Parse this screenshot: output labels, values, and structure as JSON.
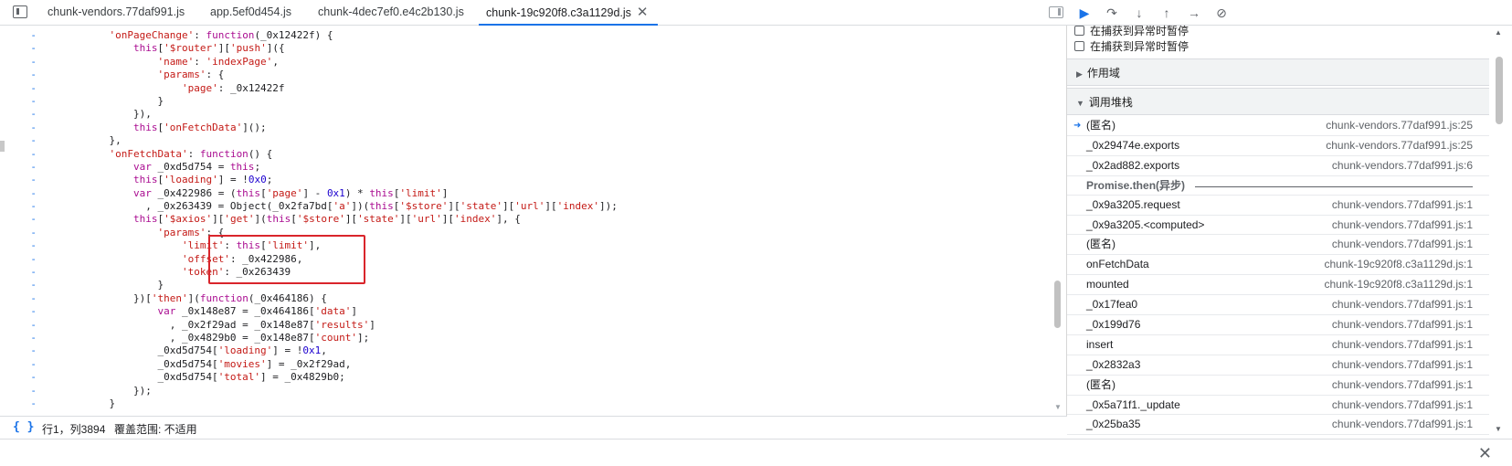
{
  "tabs": [
    {
      "label": "chunk-vendors.77daf991.js",
      "active": false
    },
    {
      "label": "app.5ef0d454.js",
      "active": false
    },
    {
      "label": "chunk-4dec7ef0.e4c2b130.js",
      "active": false
    },
    {
      "label": "chunk-19c920f8.c3a1129d.js",
      "active": true
    }
  ],
  "tab_close_glyph": "✕",
  "code_lines": [
    {
      "mark": "-",
      "html": "            <span class='c-str'>'onPageChange'</span>: <span class='c-kw'>function</span>(_0x12422f) {"
    },
    {
      "mark": "-",
      "html": "                <span class='c-kw'>this</span>[<span class='c-str'>'$router'</span>][<span class='c-str'>'push'</span>]({"
    },
    {
      "mark": "-",
      "html": "                    <span class='c-str'>'name'</span>: <span class='c-str'>'indexPage'</span>,"
    },
    {
      "mark": "-",
      "html": "                    <span class='c-str'>'params'</span>: {"
    },
    {
      "mark": "-",
      "html": "                        <span class='c-str'>'page'</span>: _0x12422f"
    },
    {
      "mark": "-",
      "html": "                    }"
    },
    {
      "mark": "-",
      "html": "                }),"
    },
    {
      "mark": "-",
      "html": "                <span class='c-kw'>this</span>[<span class='c-str'>'onFetchData'</span>]();"
    },
    {
      "mark": "-",
      "html": "            },"
    },
    {
      "mark": "-",
      "html": "            <span class='c-str'>'onFetchData'</span>: <span class='c-kw'>function</span>() {"
    },
    {
      "mark": "-",
      "html": "                <span class='c-kw'>var</span> _0xd5d754 = <span class='c-kw'>this</span>;"
    },
    {
      "mark": "-",
      "html": "                <span class='c-kw'>this</span>[<span class='c-str'>'loading'</span>] = !<span class='c-num'>0x0</span>;"
    },
    {
      "mark": "-",
      "html": "                <span class='c-kw'>var</span> _0x422986 = (<span class='c-kw'>this</span>[<span class='c-str'>'page'</span>] - <span class='c-num'>0x1</span>) * <span class='c-kw'>this</span>[<span class='c-str'>'limit'</span>]"
    },
    {
      "mark": "-",
      "html": "                  , _0x263439 = Object(_0x2fa7bd[<span class='c-str'>'a'</span>])(<span class='c-kw'>this</span>[<span class='c-str'>'$store'</span>][<span class='c-str'>'state'</span>][<span class='c-str'>'url'</span>][<span class='c-str'>'index'</span>]);"
    },
    {
      "mark": "-",
      "html": "                <span class='c-kw'>this</span>[<span class='c-str'>'$axios'</span>][<span class='c-str'>'get'</span>](<span class='c-kw'>this</span>[<span class='c-str'>'$store'</span>][<span class='c-str'>'state'</span>][<span class='c-str'>'url'</span>][<span class='c-str'>'index'</span>], {"
    },
    {
      "mark": "-",
      "html": "                    <span class='c-str'>'params'</span>: {"
    },
    {
      "mark": "-",
      "html": "                        <span class='c-str'>'limit'</span>: <span class='c-kw'>this</span>[<span class='c-str'>'limit'</span>],"
    },
    {
      "mark": "-",
      "html": "                        <span class='c-str'>'offset'</span>: _0x422986,"
    },
    {
      "mark": "-",
      "html": "                        <span class='c-str'>'token'</span>: _0x263439"
    },
    {
      "mark": "-",
      "html": "                    }"
    },
    {
      "mark": "-",
      "html": "                })[<span class='c-str'>'then'</span>](<span class='c-kw'>function</span>(_0x464186) {"
    },
    {
      "mark": "-",
      "html": "                    <span class='c-kw'>var</span> _0x148e87 = _0x464186[<span class='c-str'>'data'</span>]"
    },
    {
      "mark": "-",
      "html": "                      , _0x2f29ad = _0x148e87[<span class='c-str'>'results'</span>]"
    },
    {
      "mark": "-",
      "html": "                      , _0x4829b0 = _0x148e87[<span class='c-str'>'count'</span>];"
    },
    {
      "mark": "-",
      "html": "                    _0xd5d754[<span class='c-str'>'loading'</span>] = !<span class='c-num'>0x1</span>,"
    },
    {
      "mark": "-",
      "html": "                    _0xd5d754[<span class='c-str'>'movies'</span>] = _0x2f29ad,"
    },
    {
      "mark": "-",
      "html": "                    _0xd5d754[<span class='c-str'>'total'</span>] = _0x4829b0;"
    },
    {
      "mark": "-",
      "html": "                });"
    },
    {
      "mark": "-",
      "html": "            }"
    }
  ],
  "status": {
    "pretty_print": "{ }",
    "position": "行1，列3894",
    "coverage": "覆盖范围: 不适用"
  },
  "debugger": {
    "pause_options": [
      "在捕获到异常时暂停",
      "在捕获到异常时暂停"
    ],
    "scope_label": "作用域",
    "callstack_label": "调用堆栈",
    "async_label": "Promise.then(异步)",
    "frames_before_async": [
      {
        "name": "(匿名)",
        "location": "chunk-vendors.77daf991.js:25",
        "current": true
      },
      {
        "name": "_0x29474e.exports",
        "location": "chunk-vendors.77daf991.js:25",
        "current": false
      },
      {
        "name": "_0x2ad882.exports",
        "location": "chunk-vendors.77daf991.js:6",
        "current": false
      }
    ],
    "frames_after_async": [
      {
        "name": "_0x9a3205.request",
        "location": "chunk-vendors.77daf991.js:1"
      },
      {
        "name": "_0x9a3205.<computed>",
        "location": "chunk-vendors.77daf991.js:1"
      },
      {
        "name": "(匿名)",
        "location": "chunk-vendors.77daf991.js:1"
      },
      {
        "name": "onFetchData",
        "location": "chunk-19c920f8.c3a1129d.js:1"
      },
      {
        "name": "mounted",
        "location": "chunk-19c920f8.c3a1129d.js:1"
      },
      {
        "name": "_0x17fea0",
        "location": "chunk-vendors.77daf991.js:1"
      },
      {
        "name": "_0x199d76",
        "location": "chunk-vendors.77daf991.js:1"
      },
      {
        "name": "insert",
        "location": "chunk-vendors.77daf991.js:1"
      },
      {
        "name": "_0x2832a3",
        "location": "chunk-vendors.77daf991.js:1"
      },
      {
        "name": "(匿名)",
        "location": "chunk-vendors.77daf991.js:1"
      },
      {
        "name": "_0x5a71f1._update",
        "location": "chunk-vendors.77daf991.js:1"
      },
      {
        "name": "_0x25ba35",
        "location": "chunk-vendors.77daf991.js:1"
      }
    ]
  },
  "icons": {
    "resume": "resume-icon",
    "step_over": "step-over-icon",
    "step_into": "step-into-icon",
    "step_out": "step-out-icon",
    "step": "step-icon",
    "deactivate": "deactivate-breakpoints-icon"
  },
  "colors": {
    "accent": "#1a73e8",
    "highlight_box": "#d9252b",
    "string": "#c41a16",
    "keyword": "#aa0d91",
    "number": "#1c00cf"
  }
}
